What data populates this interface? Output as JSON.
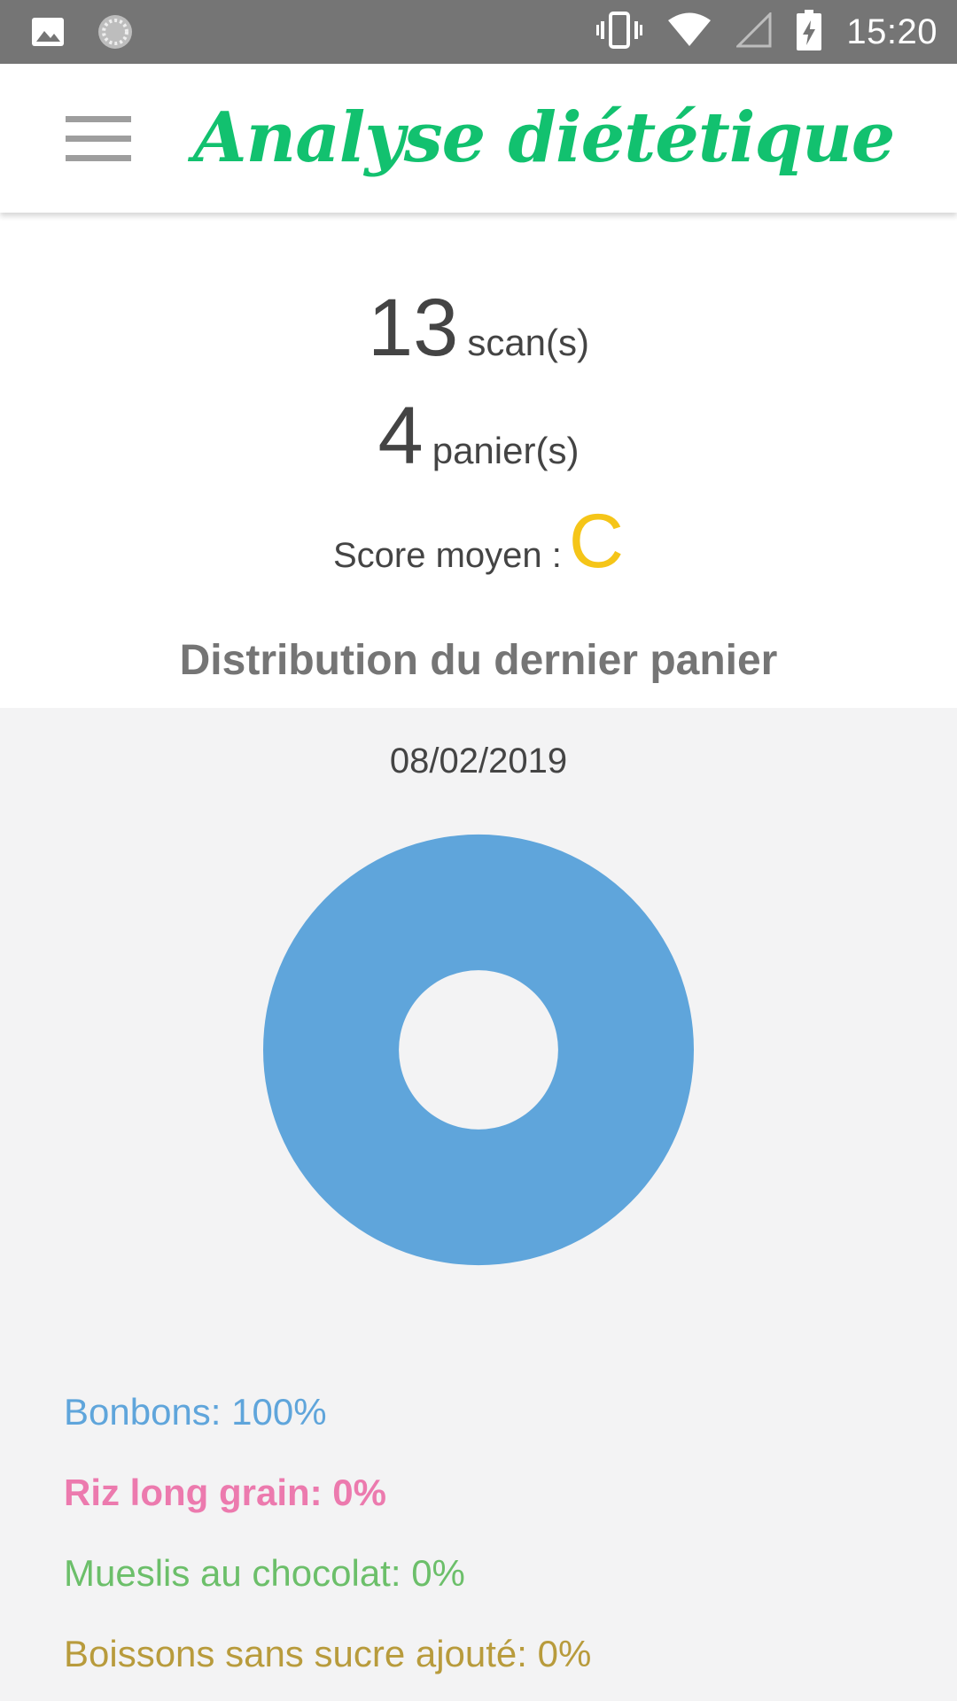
{
  "status_bar": {
    "time": "15:20",
    "colors": {
      "background": "#757575",
      "foreground": "#ffffff"
    },
    "icons": [
      "image-icon",
      "sync-icon",
      "vibrate-icon",
      "wifi-icon",
      "signal-icon",
      "battery-charging-icon"
    ]
  },
  "app_bar": {
    "title": "Analyse diététique",
    "title_color": "#12c16f",
    "menu_icon": "hamburger-menu-icon"
  },
  "stats": {
    "scans_count": "13",
    "scans_unit": "scan(s)",
    "baskets_count": "4",
    "baskets_unit": "panier(s)",
    "score_label": "Score moyen :",
    "score_value": "C",
    "score_color": "#f5c518"
  },
  "distribution": {
    "title": "Distribution du dernier panier",
    "date": "08/02/2019"
  },
  "chart_data": {
    "type": "pie",
    "hole": 0.37,
    "categories": [
      "Bonbons",
      "Riz long grain",
      "Mueslis au chocolat",
      "Boissons sans sucre ajouté"
    ],
    "values": [
      100,
      0,
      0,
      0
    ],
    "colors": [
      "#5fa5db",
      "#ec7aae",
      "#6cbf6a",
      "#b89b3c"
    ],
    "legend": {
      "placement": "bottom",
      "entries": [
        {
          "label": "Bonbons: 100%",
          "color": "#5fa5db",
          "bold": false
        },
        {
          "label": "Riz long grain: 0%",
          "color": "#ec7aae",
          "bold": true
        },
        {
          "label": "Mueslis au chocolat: 0%",
          "color": "#6cbf6a",
          "bold": false
        },
        {
          "label": "Boissons sans sucre ajouté: 0%",
          "color": "#b89b3c",
          "bold": false
        }
      ]
    }
  }
}
